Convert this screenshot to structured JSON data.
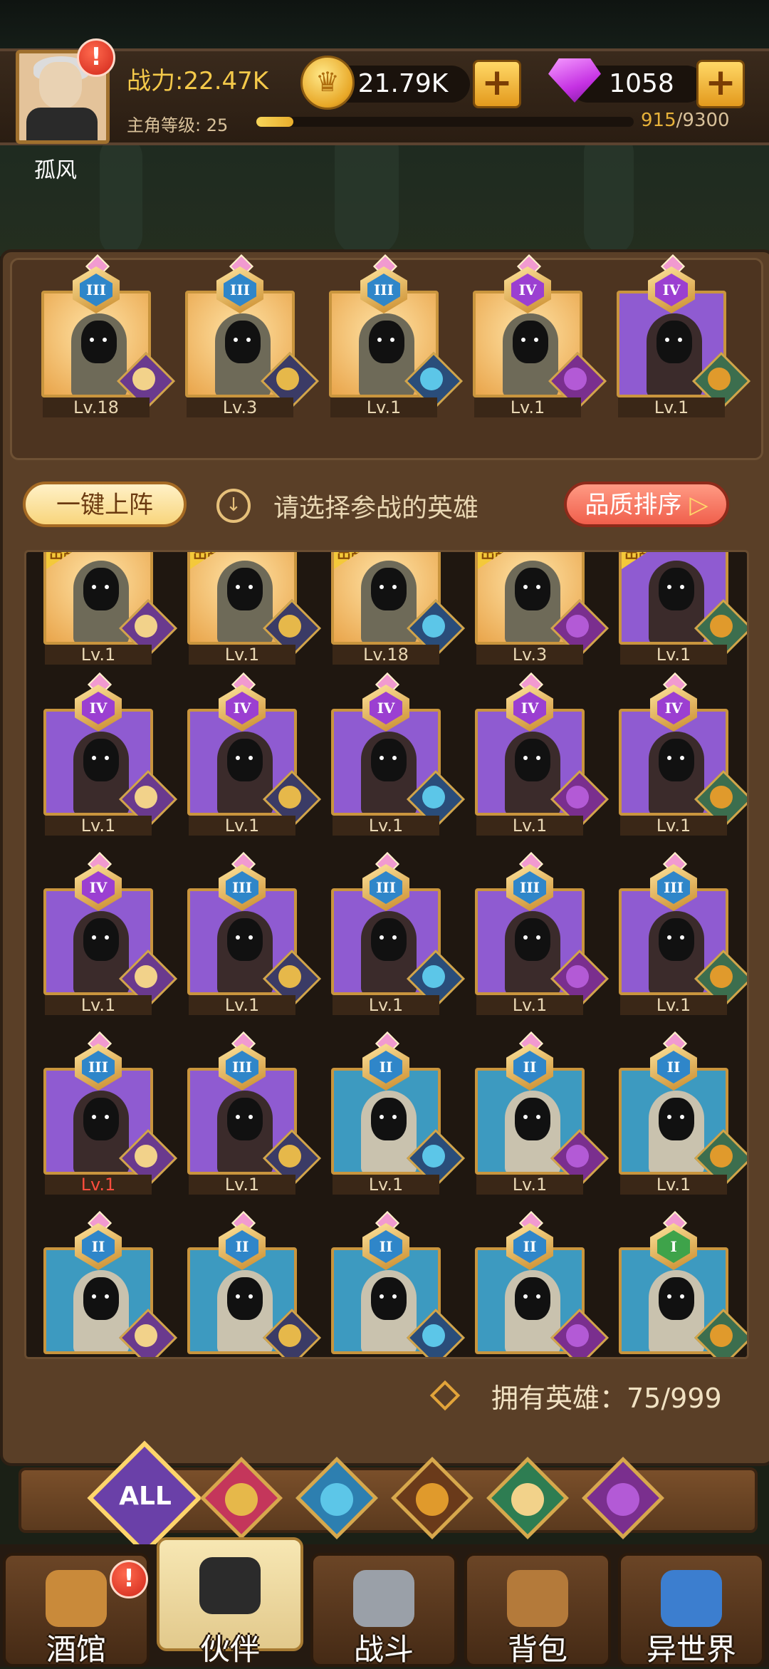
{
  "header": {
    "player_name": "孤风",
    "power": "战力:22.47K",
    "level_label": "主角等级: 25",
    "exp_current": "915",
    "exp_total": "/9300",
    "exp_progress": 0.098,
    "gold": "21.79K",
    "gems": "1058",
    "alert": "!"
  },
  "team": [
    {
      "rank": "III",
      "level": "Lv.18",
      "bg": "gold"
    },
    {
      "rank": "III",
      "level": "Lv.3",
      "bg": "gold"
    },
    {
      "rank": "III",
      "level": "Lv.1",
      "bg": "gold"
    },
    {
      "rank": "IV",
      "level": "Lv.1",
      "bg": "gold"
    },
    {
      "rank": "IV",
      "level": "Lv.1",
      "bg": "purple"
    }
  ],
  "controls": {
    "one_key": "一键上阵",
    "hint": "请选择参战的英雄",
    "sort": "品质排序",
    "deploy_badge": "出战"
  },
  "roster_rows": [
    [
      {
        "level": "Lv.1",
        "bg": "gold",
        "deployed": true
      },
      {
        "level": "Lv.1",
        "bg": "gold",
        "deployed": true
      },
      {
        "level": "Lv.18",
        "bg": "gold",
        "deployed": true
      },
      {
        "level": "Lv.3",
        "bg": "gold",
        "deployed": true
      },
      {
        "level": "Lv.1",
        "bg": "purple",
        "deployed": true
      }
    ],
    [
      {
        "rank": "IV",
        "level": "Lv.1",
        "bg": "purple"
      },
      {
        "rank": "IV",
        "level": "Lv.1",
        "bg": "purple"
      },
      {
        "rank": "IV",
        "level": "Lv.1",
        "bg": "purple"
      },
      {
        "rank": "IV",
        "level": "Lv.1",
        "bg": "purple"
      },
      {
        "rank": "IV",
        "level": "Lv.1",
        "bg": "purple"
      }
    ],
    [
      {
        "rank": "IV",
        "level": "Lv.1",
        "bg": "purple"
      },
      {
        "rank": "III",
        "level": "Lv.1",
        "bg": "purple"
      },
      {
        "rank": "III",
        "level": "Lv.1",
        "bg": "purple"
      },
      {
        "rank": "III",
        "level": "Lv.1",
        "bg": "purple"
      },
      {
        "rank": "III",
        "level": "Lv.1",
        "bg": "purple"
      }
    ],
    [
      {
        "rank": "III",
        "level": "Lv.1",
        "bg": "purple",
        "level_red": true
      },
      {
        "rank": "III",
        "level": "Lv.1",
        "bg": "purple"
      },
      {
        "rank": "II",
        "level": "Lv.1",
        "bg": "blue"
      },
      {
        "rank": "II",
        "level": "Lv.1",
        "bg": "blue"
      },
      {
        "rank": "II",
        "level": "Lv.1",
        "bg": "blue"
      }
    ],
    [
      {
        "rank": "II",
        "bg": "blue"
      },
      {
        "rank": "II",
        "bg": "blue"
      },
      {
        "rank": "II",
        "bg": "blue"
      },
      {
        "rank": "II",
        "bg": "blue"
      },
      {
        "rank": "I",
        "bg": "blue"
      }
    ]
  ],
  "owned_heroes": "拥有英雄：75/999",
  "filters": {
    "all_label": "ALL",
    "factions": [
      "warrior-faction-icon",
      "beast-faction-icon",
      "lion-faction-icon",
      "elf-faction-icon",
      "demon-faction-icon"
    ]
  },
  "nav": [
    {
      "label": "酒馆",
      "icon": "beer-mug-icon",
      "alert": "!"
    },
    {
      "label": "伙伴",
      "icon": "partner-icon",
      "active": true
    },
    {
      "label": "战斗",
      "icon": "crossed-swords-icon"
    },
    {
      "label": "背包",
      "icon": "backpack-icon"
    },
    {
      "label": "异世界",
      "icon": "portal-icon"
    }
  ]
}
